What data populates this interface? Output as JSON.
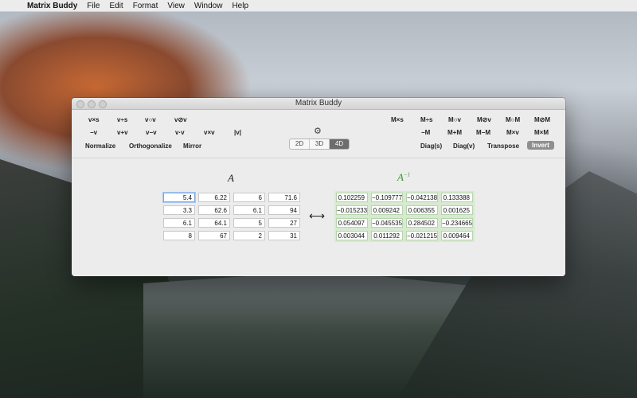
{
  "menubar": {
    "app_name": "Matrix Buddy",
    "items": [
      "File",
      "Edit",
      "Format",
      "View",
      "Window",
      "Help"
    ]
  },
  "window": {
    "title": "Matrix Buddy"
  },
  "toolbar": {
    "vector_ops_row1": [
      "v×s",
      "v÷s",
      "v○v",
      "v⊘v"
    ],
    "vector_ops_row2": [
      "−v",
      "v+v",
      "v−v",
      "v·v",
      "v×v",
      "|v|"
    ],
    "vector_ops_row3": [
      "Normalize",
      "Orthogonalize",
      "Mirror"
    ],
    "matrix_ops_row1": [
      "M×s",
      "M÷s",
      "M○v",
      "M⊘v",
      "M○M",
      "M⊘M"
    ],
    "matrix_ops_row2": [
      "−M",
      "M+M",
      "M−M",
      "M×v",
      "M×M"
    ],
    "matrix_ops_row3": [
      "Diag(s)",
      "Diag(v)",
      "Transpose",
      "Invert"
    ],
    "dimensions": [
      "2D",
      "3D",
      "4D"
    ],
    "selected_dimension": "4D"
  },
  "matrix_a": {
    "label": "A",
    "rows": [
      [
        "5.4",
        "6.22",
        "6",
        "71.6"
      ],
      [
        "3.3",
        "62.6",
        "6.1",
        "94"
      ],
      [
        "6.1",
        "64.1",
        "5",
        "27"
      ],
      [
        "8",
        "67",
        "2",
        "31"
      ]
    ]
  },
  "arrow_symbol": "⟷",
  "matrix_inverse": {
    "label": "A",
    "superscript": "−1",
    "rows": [
      [
        "0.102259",
        "−0.109777",
        "−0.042138",
        "0.133388"
      ],
      [
        "−0.015233",
        "0.009242",
        "0.006355",
        "0.001625"
      ],
      [
        "0.054097",
        "−0.045535",
        "0.284502",
        "−0.234665"
      ],
      [
        "0.003044",
        "0.011292",
        "−0.021215",
        "0.009464"
      ]
    ]
  },
  "colors": {
    "inverse_label": "#3a9a2c",
    "active_segment": "#6d6d6d"
  }
}
